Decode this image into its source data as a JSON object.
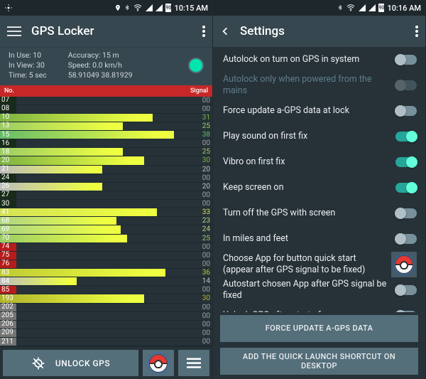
{
  "left": {
    "status": {
      "time": "10:15 AM",
      "battery": "90"
    },
    "appbar": {
      "title": "GPS Locker"
    },
    "info": {
      "in_use": "In Use: 10",
      "in_view": "In View: 30",
      "time": "Time: 5 sec",
      "accuracy": "Accuracy: 15 m",
      "speed": "Speed: 0.0 km/h",
      "coords": "58.91049 38.81929"
    },
    "table": {
      "num_header": "No.",
      "signal_header": "Signal"
    },
    "sats": [
      {
        "num": "07",
        "signal": "00",
        "len": 0,
        "ncolor": "#172b18",
        "bcolor": "",
        "scolor": "#9e9e9e"
      },
      {
        "num": "08",
        "signal": "00",
        "len": 0,
        "ncolor": "#172b18",
        "bcolor": "",
        "scolor": "#9e9e9e"
      },
      {
        "num": "10",
        "signal": "31",
        "len": 72,
        "ncolor": "#cddc39",
        "bcolor": "#7cb342",
        "scolor": "#7cb342"
      },
      {
        "num": "13",
        "signal": "25",
        "len": 58,
        "ncolor": "#cddc39",
        "bcolor": "#9ccc65",
        "scolor": "#9ccc65"
      },
      {
        "num": "15",
        "signal": "38",
        "len": 82,
        "ncolor": "#cddc39",
        "bcolor": "#66bb6a",
        "scolor": "#66bb6a"
      },
      {
        "num": "16",
        "signal": "00",
        "len": 0,
        "ncolor": "#172b18",
        "bcolor": "",
        "scolor": "#9e9e9e"
      },
      {
        "num": "18",
        "signal": "25",
        "len": 58,
        "ncolor": "#cddc39",
        "bcolor": "#9ccc65",
        "scolor": "#9ccc65"
      },
      {
        "num": "20",
        "signal": "30",
        "len": 68,
        "ncolor": "#cddc39",
        "bcolor": "#7cb342",
        "scolor": "#7cb342"
      },
      {
        "num": "21",
        "signal": "20",
        "len": 48,
        "ncolor": "#9e9e9e",
        "bcolor": "#bdbdbd",
        "scolor": "#bdbdbd"
      },
      {
        "num": "24",
        "signal": "00",
        "len": 0,
        "ncolor": "#172b18",
        "bcolor": "",
        "scolor": "#9e9e9e"
      },
      {
        "num": "26",
        "signal": "20",
        "len": 48,
        "ncolor": "#9e9e9e",
        "bcolor": "#bdbdbd",
        "scolor": "#bdbdbd"
      },
      {
        "num": "27",
        "signal": "00",
        "len": 0,
        "ncolor": "#172b18",
        "bcolor": "",
        "scolor": "#9e9e9e"
      },
      {
        "num": "30",
        "signal": "00",
        "len": 0,
        "ncolor": "#172b18",
        "bcolor": "",
        "scolor": "#9e9e9e"
      },
      {
        "num": "41",
        "signal": "33",
        "len": 74,
        "ncolor": "#cddc39",
        "bcolor": "#d4e157",
        "scolor": "#d4e157"
      },
      {
        "num": "68",
        "signal": "23",
        "len": 55,
        "ncolor": "#cddc39",
        "bcolor": "#aed581",
        "scolor": "#aed581"
      },
      {
        "num": "69",
        "signal": "24",
        "len": 57,
        "ncolor": "#cddc39",
        "bcolor": "#aed581",
        "scolor": "#aed581"
      },
      {
        "num": "70",
        "signal": "25",
        "len": 60,
        "ncolor": "#cddc39",
        "bcolor": "#9ccc65",
        "scolor": "#9ccc65"
      },
      {
        "num": "74",
        "signal": "00",
        "len": 0,
        "ncolor": "#b71c1c",
        "bcolor": "",
        "scolor": "#9e9e9e"
      },
      {
        "num": "75",
        "signal": "00",
        "len": 0,
        "ncolor": "#b71c1c",
        "bcolor": "",
        "scolor": "#9e9e9e"
      },
      {
        "num": "76",
        "signal": "00",
        "len": 0,
        "ncolor": "#b71c1c",
        "bcolor": "",
        "scolor": "#9e9e9e"
      },
      {
        "num": "83",
        "signal": "36",
        "len": 78,
        "ncolor": "#ff7043",
        "bcolor": "#c0ca33",
        "scolor": "#c0ca33"
      },
      {
        "num": "84",
        "signal": "14",
        "len": 36,
        "ncolor": "#ff8a65",
        "bcolor": "#bdbdbd",
        "scolor": "#bdbdbd"
      },
      {
        "num": "85",
        "signal": "00",
        "len": 0,
        "ncolor": "#b71c1c",
        "bcolor": "",
        "scolor": "#9e9e9e"
      },
      {
        "num": "193",
        "signal": "30",
        "len": 68,
        "ncolor": "#9e9e9e",
        "bcolor": "#afb42b",
        "scolor": "#afb42b"
      },
      {
        "num": "202",
        "signal": "00",
        "len": 0,
        "ncolor": "#757575",
        "bcolor": "",
        "scolor": "#9e9e9e"
      },
      {
        "num": "205",
        "signal": "00",
        "len": 0,
        "ncolor": "#757575",
        "bcolor": "",
        "scolor": "#9e9e9e"
      },
      {
        "num": "206",
        "signal": "00",
        "len": 0,
        "ncolor": "#757575",
        "bcolor": "",
        "scolor": "#9e9e9e"
      },
      {
        "num": "209",
        "signal": "00",
        "len": 0,
        "ncolor": "#757575",
        "bcolor": "",
        "scolor": "#9e9e9e"
      },
      {
        "num": "211",
        "signal": "00",
        "len": 0,
        "ncolor": "#757575",
        "bcolor": "",
        "scolor": "#9e9e9e"
      }
    ],
    "unlock": "UNLOCK GPS"
  },
  "right": {
    "status": {
      "time": "10:16 AM",
      "battery": "90"
    },
    "appbar": {
      "title": "Settings"
    },
    "items": [
      {
        "label": "Autolock on turn on GPS in system",
        "type": "toggle",
        "on": false,
        "disabled": false
      },
      {
        "label": "Autolock only when powered from the mains",
        "type": "toggle",
        "on": false,
        "disabled": true
      },
      {
        "label": "Force update a-GPS data at lock",
        "type": "toggle",
        "on": false,
        "disabled": false
      },
      {
        "label": "Play sound on first fix",
        "type": "toggle",
        "on": true,
        "disabled": false
      },
      {
        "label": "Vibro on first fix",
        "type": "toggle",
        "on": true,
        "disabled": false
      },
      {
        "label": "Keep screen on",
        "type": "toggle",
        "on": true,
        "disabled": false
      },
      {
        "label": "Turn off the GPS with screen",
        "type": "toggle",
        "on": false,
        "disabled": false
      },
      {
        "label": "In miles and feet",
        "type": "toggle",
        "on": false,
        "disabled": false
      },
      {
        "label": "Choose App for button quick start (appear after GPS signal to be fixed)",
        "type": "app",
        "on": false,
        "disabled": false
      },
      {
        "label": "Autostart chosen App after GPS signal be fixed",
        "type": "toggle",
        "on": false,
        "disabled": false
      },
      {
        "label": "Unlock GPS after start of app.",
        "type": "toggle",
        "on": false,
        "disabled": false
      }
    ],
    "btn1": "FORCE UPDATE A-GPS DATA",
    "btn2": "ADD THE QUICK LAUNCH SHORTCUT ON DESKTOP"
  }
}
